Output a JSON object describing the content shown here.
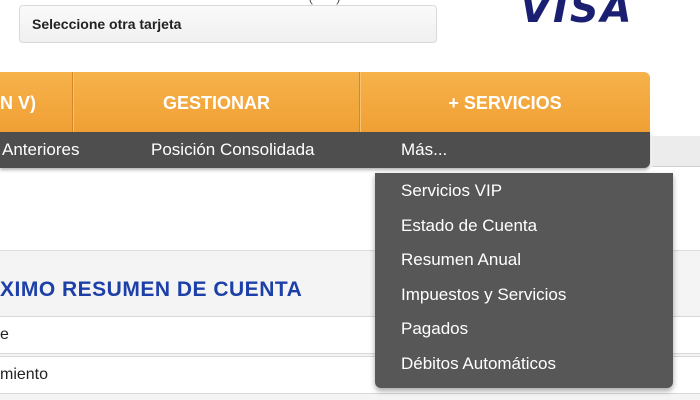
{
  "header": {
    "top_partial_text": "•••• •••• (••••)",
    "card_select_label": "Seleccione otra tarjeta",
    "brand_logo": "VISA"
  },
  "main_nav": {
    "items": [
      {
        "label": "N V)"
      },
      {
        "label": "GESTIONAR"
      },
      {
        "label": "+ SERVICIOS"
      }
    ]
  },
  "sub_nav": {
    "items": [
      {
        "label": "Anteriores"
      },
      {
        "label": "Posición Consolidada"
      },
      {
        "label": "Más..."
      }
    ]
  },
  "dropdown": {
    "items": [
      {
        "label": "Servicios VIP"
      },
      {
        "label": "Estado de Cuenta"
      },
      {
        "label": "Resumen Anual"
      },
      {
        "label": "Impuestos y Servicios"
      },
      {
        "label": "Pagados"
      },
      {
        "label": "Débitos Automáticos"
      }
    ]
  },
  "content": {
    "section_title": "XIMO RESUMEN DE CUENTA",
    "rows": [
      {
        "label": "e"
      },
      {
        "label": "miento"
      }
    ]
  },
  "colors": {
    "nav_orange": "#f0a035",
    "subnav_dark": "#4f4e4e",
    "dropdown_bg": "#585757",
    "title_blue": "#1d3fa8",
    "visa_blue": "#1a1f71"
  }
}
